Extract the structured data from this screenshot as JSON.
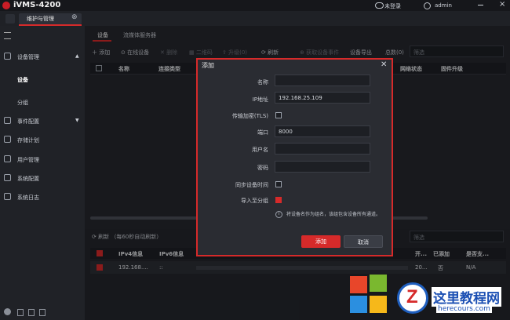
{
  "app": {
    "title": "iVMS-4200",
    "tab_label": "维护与管理",
    "user_status": "未登录",
    "user_name": "admin"
  },
  "sidebar": {
    "items": [
      {
        "label": "设备管理",
        "icon": "device-manage-icon"
      },
      {
        "label": "设备"
      },
      {
        "label": "分组"
      },
      {
        "label": "事件配置",
        "icon": "event-icon"
      },
      {
        "label": "存储计划",
        "icon": "storage-icon"
      },
      {
        "label": "用户管理",
        "icon": "user-icon"
      },
      {
        "label": "系统配置",
        "icon": "gear-icon"
      },
      {
        "label": "系统日志",
        "icon": "log-icon"
      }
    ]
  },
  "main": {
    "tabs": [
      "设备",
      "流媒体服务器"
    ],
    "toolbar": [
      "添加",
      "在线设备",
      "删除",
      "二维码",
      "升级(0)",
      "刷新",
      "获取设备事件",
      "设备导出",
      "总数(0)"
    ],
    "filter_placeholder": "筛选",
    "columns": [
      "名称",
      "连接类型",
      "网络状态",
      "固件升级"
    ]
  },
  "dialog": {
    "title": "添加",
    "fields": {
      "name_label": "名称",
      "name_value": "",
      "ip_label": "IP地址",
      "ip_value": "192.168.25.109",
      "tls_label": "传输加密(TLS)",
      "port_label": "端口",
      "port_value": "8000",
      "user_label": "用户名",
      "user_value": "",
      "pwd_label": "密码",
      "pwd_value": "",
      "sync_label": "同步设备时间",
      "group_label": "导入至分组",
      "info_text": "将设备名作为组名，该组包含设备所有通道。"
    },
    "ok_label": "添加",
    "cancel_label": "取消"
  },
  "bottom": {
    "refresh_label": "刷新 （每60秒自动刷新）",
    "filter_placeholder": "筛选",
    "columns": [
      "IPv4信息",
      "IPv6信息",
      "开...",
      "已添加",
      "是否支..."
    ],
    "row": {
      "ipv4": "192.168....",
      "ipv6": "::",
      "port": "20...",
      "added": "否",
      "support": "N/A"
    }
  },
  "watermark": {
    "line1": "这里教程网",
    "line2": "herecours.com"
  },
  "colors": {
    "accent": "#d62a2a",
    "bg": "#1b1d22"
  }
}
